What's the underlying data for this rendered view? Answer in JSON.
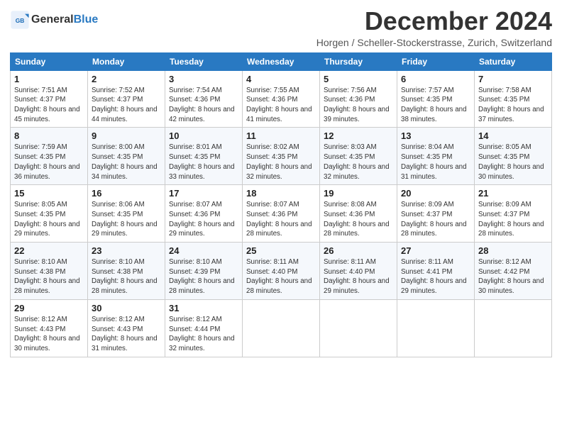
{
  "header": {
    "logo_line1": "General",
    "logo_line2": "Blue",
    "month_title": "December 2024",
    "subtitle": "Horgen / Scheller-Stockerstrasse, Zurich, Switzerland"
  },
  "weekdays": [
    "Sunday",
    "Monday",
    "Tuesday",
    "Wednesday",
    "Thursday",
    "Friday",
    "Saturday"
  ],
  "weeks": [
    [
      {
        "day": "1",
        "sunrise": "7:51 AM",
        "sunset": "4:37 PM",
        "daylight": "8 hours and 45 minutes."
      },
      {
        "day": "2",
        "sunrise": "7:52 AM",
        "sunset": "4:37 PM",
        "daylight": "8 hours and 44 minutes."
      },
      {
        "day": "3",
        "sunrise": "7:54 AM",
        "sunset": "4:36 PM",
        "daylight": "8 hours and 42 minutes."
      },
      {
        "day": "4",
        "sunrise": "7:55 AM",
        "sunset": "4:36 PM",
        "daylight": "8 hours and 41 minutes."
      },
      {
        "day": "5",
        "sunrise": "7:56 AM",
        "sunset": "4:36 PM",
        "daylight": "8 hours and 39 minutes."
      },
      {
        "day": "6",
        "sunrise": "7:57 AM",
        "sunset": "4:35 PM",
        "daylight": "8 hours and 38 minutes."
      },
      {
        "day": "7",
        "sunrise": "7:58 AM",
        "sunset": "4:35 PM",
        "daylight": "8 hours and 37 minutes."
      }
    ],
    [
      {
        "day": "8",
        "sunrise": "7:59 AM",
        "sunset": "4:35 PM",
        "daylight": "8 hours and 36 minutes."
      },
      {
        "day": "9",
        "sunrise": "8:00 AM",
        "sunset": "4:35 PM",
        "daylight": "8 hours and 34 minutes."
      },
      {
        "day": "10",
        "sunrise": "8:01 AM",
        "sunset": "4:35 PM",
        "daylight": "8 hours and 33 minutes."
      },
      {
        "day": "11",
        "sunrise": "8:02 AM",
        "sunset": "4:35 PM",
        "daylight": "8 hours and 32 minutes."
      },
      {
        "day": "12",
        "sunrise": "8:03 AM",
        "sunset": "4:35 PM",
        "daylight": "8 hours and 32 minutes."
      },
      {
        "day": "13",
        "sunrise": "8:04 AM",
        "sunset": "4:35 PM",
        "daylight": "8 hours and 31 minutes."
      },
      {
        "day": "14",
        "sunrise": "8:05 AM",
        "sunset": "4:35 PM",
        "daylight": "8 hours and 30 minutes."
      }
    ],
    [
      {
        "day": "15",
        "sunrise": "8:05 AM",
        "sunset": "4:35 PM",
        "daylight": "8 hours and 29 minutes."
      },
      {
        "day": "16",
        "sunrise": "8:06 AM",
        "sunset": "4:35 PM",
        "daylight": "8 hours and 29 minutes."
      },
      {
        "day": "17",
        "sunrise": "8:07 AM",
        "sunset": "4:36 PM",
        "daylight": "8 hours and 29 minutes."
      },
      {
        "day": "18",
        "sunrise": "8:07 AM",
        "sunset": "4:36 PM",
        "daylight": "8 hours and 28 minutes."
      },
      {
        "day": "19",
        "sunrise": "8:08 AM",
        "sunset": "4:36 PM",
        "daylight": "8 hours and 28 minutes."
      },
      {
        "day": "20",
        "sunrise": "8:09 AM",
        "sunset": "4:37 PM",
        "daylight": "8 hours and 28 minutes."
      },
      {
        "day": "21",
        "sunrise": "8:09 AM",
        "sunset": "4:37 PM",
        "daylight": "8 hours and 28 minutes."
      }
    ],
    [
      {
        "day": "22",
        "sunrise": "8:10 AM",
        "sunset": "4:38 PM",
        "daylight": "8 hours and 28 minutes."
      },
      {
        "day": "23",
        "sunrise": "8:10 AM",
        "sunset": "4:38 PM",
        "daylight": "8 hours and 28 minutes."
      },
      {
        "day": "24",
        "sunrise": "8:10 AM",
        "sunset": "4:39 PM",
        "daylight": "8 hours and 28 minutes."
      },
      {
        "day": "25",
        "sunrise": "8:11 AM",
        "sunset": "4:40 PM",
        "daylight": "8 hours and 28 minutes."
      },
      {
        "day": "26",
        "sunrise": "8:11 AM",
        "sunset": "4:40 PM",
        "daylight": "8 hours and 29 minutes."
      },
      {
        "day": "27",
        "sunrise": "8:11 AM",
        "sunset": "4:41 PM",
        "daylight": "8 hours and 29 minutes."
      },
      {
        "day": "28",
        "sunrise": "8:12 AM",
        "sunset": "4:42 PM",
        "daylight": "8 hours and 30 minutes."
      }
    ],
    [
      {
        "day": "29",
        "sunrise": "8:12 AM",
        "sunset": "4:43 PM",
        "daylight": "8 hours and 30 minutes."
      },
      {
        "day": "30",
        "sunrise": "8:12 AM",
        "sunset": "4:43 PM",
        "daylight": "8 hours and 31 minutes."
      },
      {
        "day": "31",
        "sunrise": "8:12 AM",
        "sunset": "4:44 PM",
        "daylight": "8 hours and 32 minutes."
      },
      null,
      null,
      null,
      null
    ]
  ]
}
